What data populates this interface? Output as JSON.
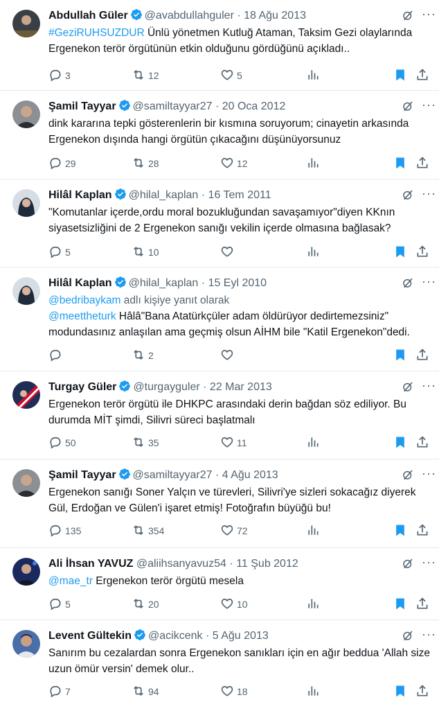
{
  "colors": {
    "accent": "#1d9bf0",
    "text": "#0f1419",
    "muted": "#536471",
    "verified": "#1d9bf0",
    "bookmark": "#1d9bf0"
  },
  "icons": [
    "grok-icon",
    "more-icon",
    "reply-icon",
    "retweet-icon",
    "like-icon",
    "views-icon",
    "bookmark-icon",
    "share-icon",
    "verified-icon"
  ],
  "tweets": [
    {
      "name": "Abdullah Güler",
      "handle": "@avabdullahguler",
      "date": "18 Ağu 2013",
      "hashtag": "#GeziRUHSUZDUR",
      "text": " Ünlü yönetmen Kutluğ Ataman, Taksim Gezi olaylarında Ergenekon terör örgütünün etkin olduğunu gördüğünü açıkladı..",
      "replies": "3",
      "retweets": "12",
      "likes": "5",
      "bookmarked": true
    },
    {
      "name": "Şamil Tayyar",
      "handle": "@samiltayyar27",
      "date": "20 Oca 2012",
      "text": "dink kararına tepki gösterenlerin bir kısmına soruyorum; cinayetin arkasında Ergenekon dışında hangi örgütün çıkacağını düşünüyorsunuz",
      "replies": "29",
      "retweets": "28",
      "likes": "12",
      "bookmarked": true
    },
    {
      "name": "Hilâl Kaplan",
      "handle": "@hilal_kaplan",
      "date": "16 Tem 2011",
      "text": "\"Komutanlar içerde,ordu moral bozukluğundan savaşamıyor\"diyen KKnın siyasetsizliğini de 2 Ergenekon sanığı vekilin içerde olmasına bağlasak?",
      "replies": "5",
      "retweets": "10",
      "likes": "",
      "bookmarked": true
    },
    {
      "name": "Hilâl Kaplan",
      "handle": "@hilal_kaplan",
      "date": "15 Eyl 2010",
      "reply_to_mention": "@bedribaykam",
      "reply_to_suffix": " adlı kişiye yanıt olarak",
      "mention": "@meettheturk",
      "text": " Hâlâ\"Bana Atatürkçüler adam öldürüyor dedirtemezsiniz\" modundasınız anlaşılan ama geçmiş olsun AİHM bile \"Katil Ergenekon\"dedi.",
      "replies": "",
      "retweets": "2",
      "likes": "",
      "bookmarked": true
    },
    {
      "name": "Turgay Güler",
      "handle": "@turgayguler",
      "date": "22 Mar 2013",
      "text": "Ergenekon terör örgütü ile DHKPC arasındaki derin bağdan söz ediliyor. Bu durumda MİT şimdi, Silivri süreci başlatmalı",
      "replies": "50",
      "retweets": "35",
      "likes": "11",
      "bookmarked": true
    },
    {
      "name": "Şamil Tayyar",
      "handle": "@samiltayyar27",
      "date": "4 Ağu 2013",
      "text": "Ergenekon sanığı Soner Yalçın ve türevleri, Silivri'ye sizleri sokacağız diyerek Gül, Erdoğan ve Gülen'i işaret etmiş! Fotoğrafın büyüğü bu!",
      "replies": "135",
      "retweets": "354",
      "likes": "72",
      "bookmarked": true
    },
    {
      "name": "Ali İhsan YAVUZ",
      "handle": "@aliihsanyavuz54",
      "date": "11 Şub 2012",
      "mention": "@mae_tr",
      "text": " Ergenekon terör örgütü mesela",
      "replies": "5",
      "retweets": "20",
      "likes": "10",
      "bookmarked": true
    },
    {
      "name": "Levent Gültekin",
      "handle": "@acikcenk",
      "date": "5 Ağu 2013",
      "text": "Sanırım bu cezalardan sonra  Ergenekon sanıkları için en ağır beddua 'Allah size uzun ömür versin' demek olur..",
      "replies": "7",
      "retweets": "94",
      "likes": "18",
      "bookmarked": true
    }
  ],
  "separator": "·"
}
